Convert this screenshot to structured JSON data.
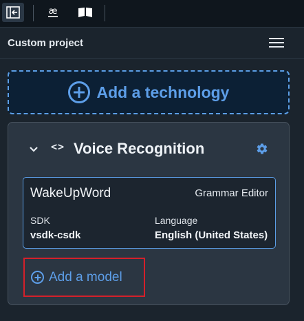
{
  "toolbar": {
    "buttons": [
      {
        "icon": "collapse-panel-icon",
        "active": true
      },
      {
        "icon": "ae-glyph-icon",
        "glyph": "æ",
        "active": false
      },
      {
        "icon": "book-icon",
        "active": false
      }
    ]
  },
  "panel": {
    "title": "Custom project",
    "menu_icon": "hamburger-menu-icon"
  },
  "add_technology": {
    "label": "Add a technology",
    "icon": "plus-circle-icon",
    "accent_color": "#5d9ee8"
  },
  "technology": {
    "title": "Voice Recognition",
    "expand_icon": "chevron-down-icon",
    "type_icon": "code-icon",
    "code_glyph": "<>",
    "settings_icon": "gear-icon",
    "model": {
      "name": "WakeUpWord",
      "editor": "Grammar Editor",
      "sdk_label": "SDK",
      "sdk_value": "vsdk-csdk",
      "language_label": "Language",
      "language_value": "English (United States)"
    },
    "add_model": {
      "label": "Add a model",
      "icon": "plus-circle-icon",
      "highlight_color": "#d5202a"
    }
  }
}
